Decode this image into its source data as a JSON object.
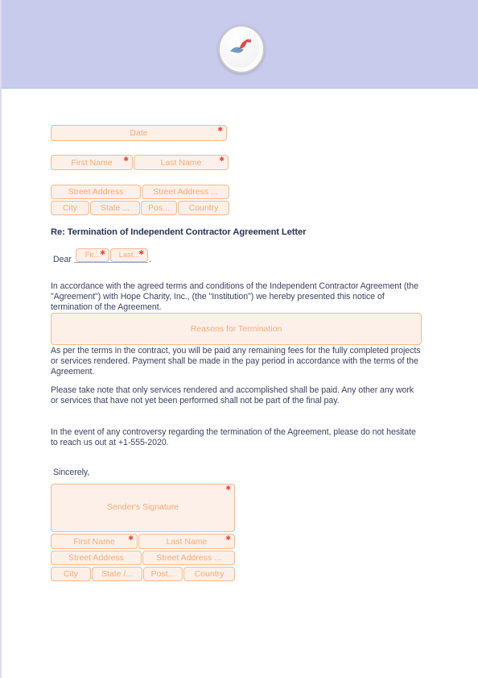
{
  "document": {
    "type": "termination-of-independent-contractor-agreement-letter",
    "accent_color": "#f5b98e",
    "field_fill_color": "#fdf0e8",
    "placeholder_color": "#f3ab78",
    "required_marker_color": "#e8453c",
    "header_band_color": "#c8cbec",
    "body_text_color": "#3d4260",
    "heading_color": "#2b3455"
  },
  "header": {
    "logo": {
      "name": "company-logo",
      "shape": "circular-badge",
      "red_color": "#e04a42",
      "blue_color": "#6b9cc4"
    }
  },
  "sender_block": {
    "date": {
      "placeholder": "Date",
      "value": "",
      "required": true
    },
    "first_name": {
      "placeholder": "First Name",
      "value": "",
      "required": true
    },
    "last_name": {
      "placeholder": "Last Name",
      "value": "",
      "required": true
    },
    "street_address_1": {
      "placeholder": "Street Address",
      "value": ""
    },
    "street_address_2": {
      "placeholder": "Street Address ...",
      "value": ""
    },
    "city": {
      "placeholder": "City",
      "value": ""
    },
    "state": {
      "placeholder": "State ...",
      "value": ""
    },
    "postal": {
      "placeholder": "Pos...",
      "value": ""
    },
    "country": {
      "placeholder": "Country",
      "value": ""
    }
  },
  "subject": {
    "text": "Re: Termination of Independent Contractor Agreement Letter"
  },
  "salutation": {
    "label": "Dear",
    "first_name": {
      "placeholder": "Fir...",
      "value": "",
      "required": true
    },
    "last_name": {
      "placeholder": "Last...",
      "value": "",
      "required": true
    },
    "punctuation": "."
  },
  "body": {
    "paragraph_1": "In accordance with the agreed terms and conditions of the Independent Contractor Agreement (the \"Agreement\") with Hope Charity, Inc., (the \"Institution\") we hereby presented this notice of termination of the Agreement.",
    "reasons_field": {
      "placeholder": "Reasons for Termination",
      "value": ""
    },
    "paragraph_2": "As per the terms in the contract, you will be paid any remaining fees for the fully completed projects or services rendered. Payment shall be made in the pay period in accordance with the terms of the Agreement.",
    "paragraph_3": "Please take note that only services rendered and accomplished shall be paid. Any other any work or services that have not yet been performed shall not be part of the final pay.",
    "paragraph_4": "In the event of any controversy regarding the termination of the Agreement, please do not hesitate to reach us out at +1-555-2020.",
    "phone": "+1-555-2020",
    "organization": "Hope Charity, Inc.",
    "closing": "Sincerely,"
  },
  "signature_block": {
    "signature": {
      "placeholder": "Sender's Signature",
      "value": "",
      "required": true
    },
    "first_name": {
      "placeholder": "First Name",
      "value": "",
      "required": true
    },
    "last_name": {
      "placeholder": "Last Name",
      "value": "",
      "required": true
    },
    "street_address_1": {
      "placeholder": "Street Address",
      "value": ""
    },
    "street_address_2": {
      "placeholder": "Street Address ...",
      "value": ""
    },
    "city": {
      "placeholder": "City",
      "value": ""
    },
    "state": {
      "placeholder": "State /...",
      "value": ""
    },
    "postal": {
      "placeholder": "Post...",
      "value": ""
    },
    "country": {
      "placeholder": "Country",
      "value": ""
    }
  }
}
